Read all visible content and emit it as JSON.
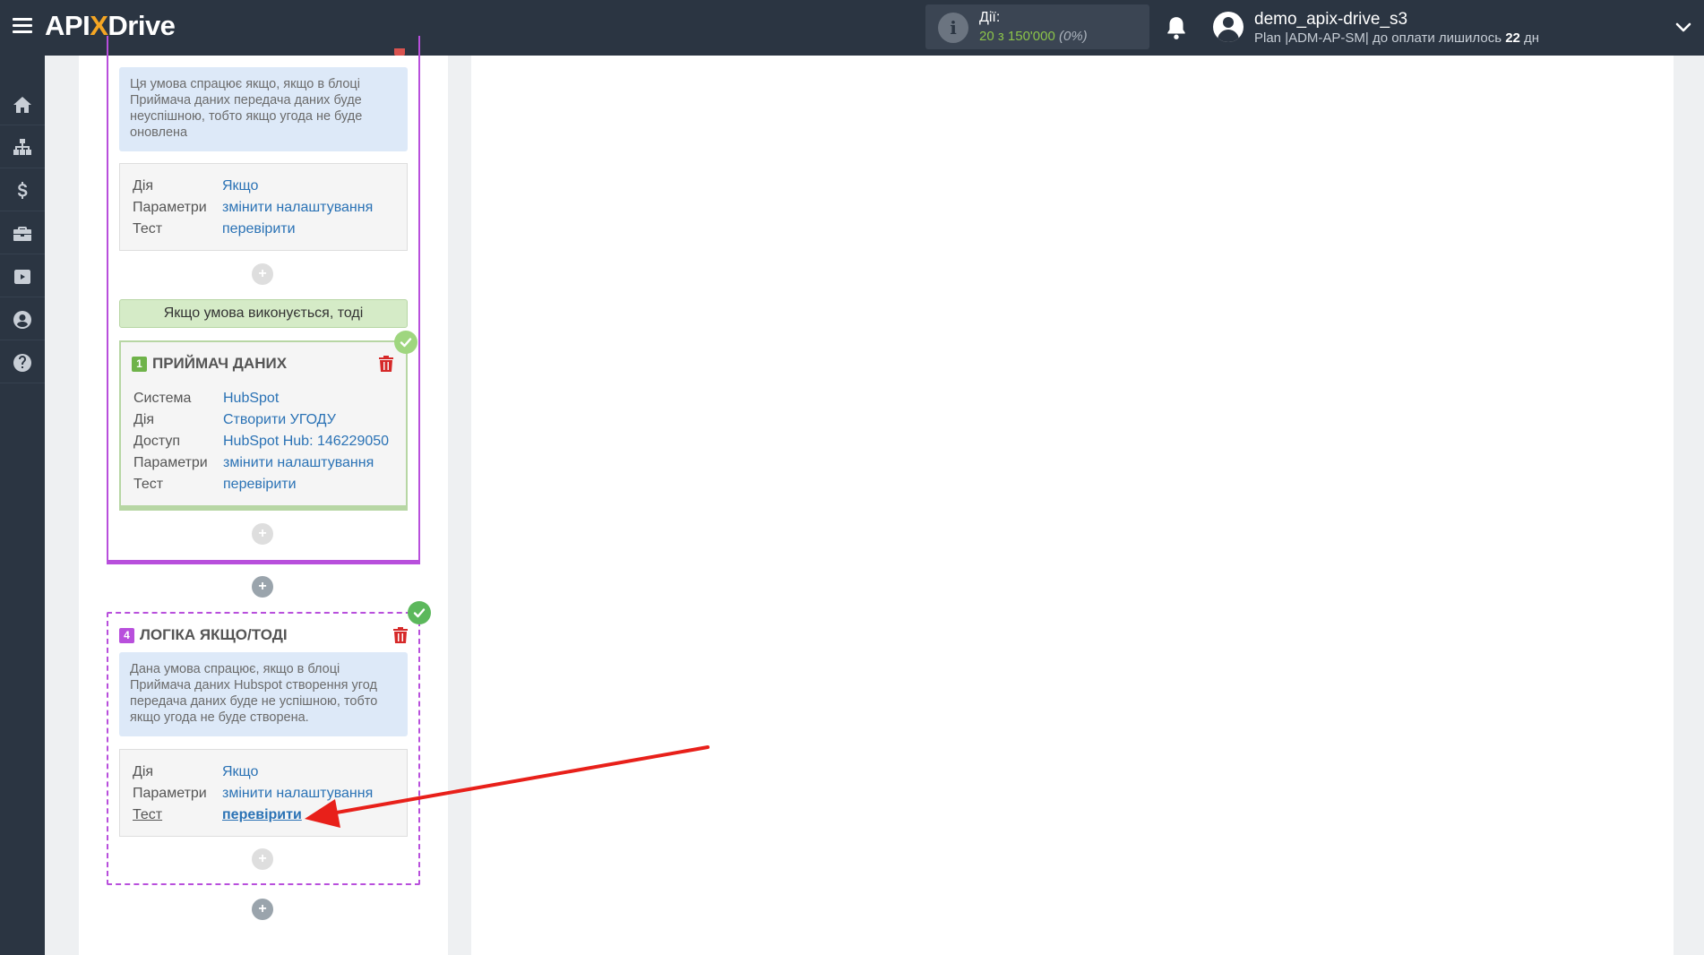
{
  "header": {
    "logo": {
      "part1": "API",
      "part2": "X",
      "part3": "Drive"
    },
    "actions": {
      "label": "Дії:",
      "value": "20 з 150'000",
      "percent": "(0%)"
    },
    "user": {
      "name": "demo_apix-drive_s3",
      "plan_prefix": "Plan |ADM-AP-SM| до оплати лишилось ",
      "days": "22",
      "days_suffix": " дн"
    }
  },
  "sidebar": {
    "items": [
      {
        "icon": "home-icon"
      },
      {
        "icon": "sitemap-icon"
      },
      {
        "icon": "dollar-icon"
      },
      {
        "icon": "briefcase-icon"
      },
      {
        "icon": "youtube-icon"
      },
      {
        "icon": "user-circle-icon"
      },
      {
        "icon": "help-icon"
      }
    ]
  },
  "block_top": {
    "description": "Ця умова спрацює якщо, якщо в блоці Приймача даних передача даних буде неуспішною, тобто якщо угода не буде оновлена",
    "rows": [
      {
        "key": "Дія",
        "value": "Якщо"
      },
      {
        "key": "Параметри",
        "value": "змінити налаштування"
      },
      {
        "key": "Тест",
        "value": "перевірити"
      }
    ]
  },
  "condition_bar": "Якщо умова виконується, тоді",
  "receiver": {
    "number": "1",
    "title": "ПРИЙМАЧ ДАНИХ",
    "rows": [
      {
        "key": "Система",
        "value": "HubSpot"
      },
      {
        "key": "Дія",
        "value": "Створити УГОДУ"
      },
      {
        "key": "Доступ",
        "value": "HubSpot Hub: 146229050"
      },
      {
        "key": "Параметри",
        "value": "змінити налаштування"
      },
      {
        "key": "Тест",
        "value": "перевірити"
      }
    ]
  },
  "logic_block": {
    "number": "4",
    "title": "ЛОГІКА ЯКЩО/ТОДІ",
    "description": "Дана умова спрацює, якщо в блоці Приймача даних Hubspot створення угод передача даних буде не успішною, тобто якщо угода не буде створена.",
    "rows": [
      {
        "key": "Дія",
        "value": "Якщо"
      },
      {
        "key": "Параметри",
        "value": "змінити налаштування"
      },
      {
        "key": "Тест",
        "value": "перевірити"
      }
    ]
  },
  "plus_label": "+",
  "colors": {
    "header_bg": "#2b3542",
    "accent_purple": "#b84fdc",
    "link_blue": "#2a72b5",
    "success_green": "#5cb85c",
    "arrow_red": "#e8201a"
  }
}
